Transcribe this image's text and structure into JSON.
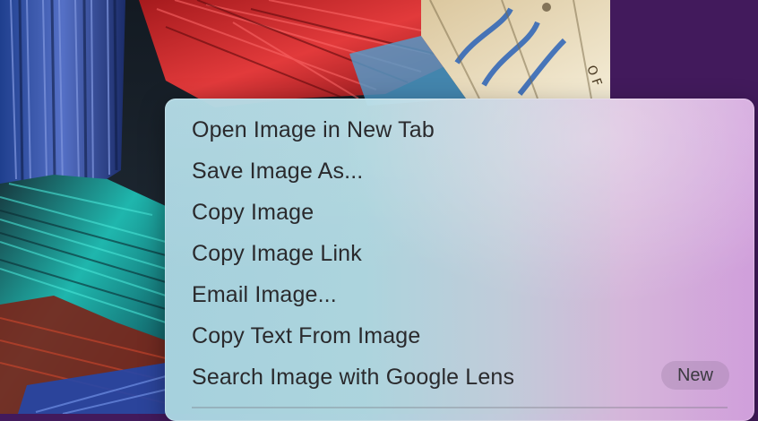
{
  "background": {
    "color": "#421a5c",
    "photo_description_icon": "paint-brushes-photo"
  },
  "context_menu": {
    "items": [
      {
        "label": "Open Image in New Tab"
      },
      {
        "label": "Save Image As..."
      },
      {
        "label": "Copy Image"
      },
      {
        "label": "Copy Image Link"
      },
      {
        "label": "Email Image..."
      },
      {
        "label": "Copy Text From Image"
      },
      {
        "label": "Search Image with Google Lens",
        "badge": "New"
      }
    ]
  }
}
